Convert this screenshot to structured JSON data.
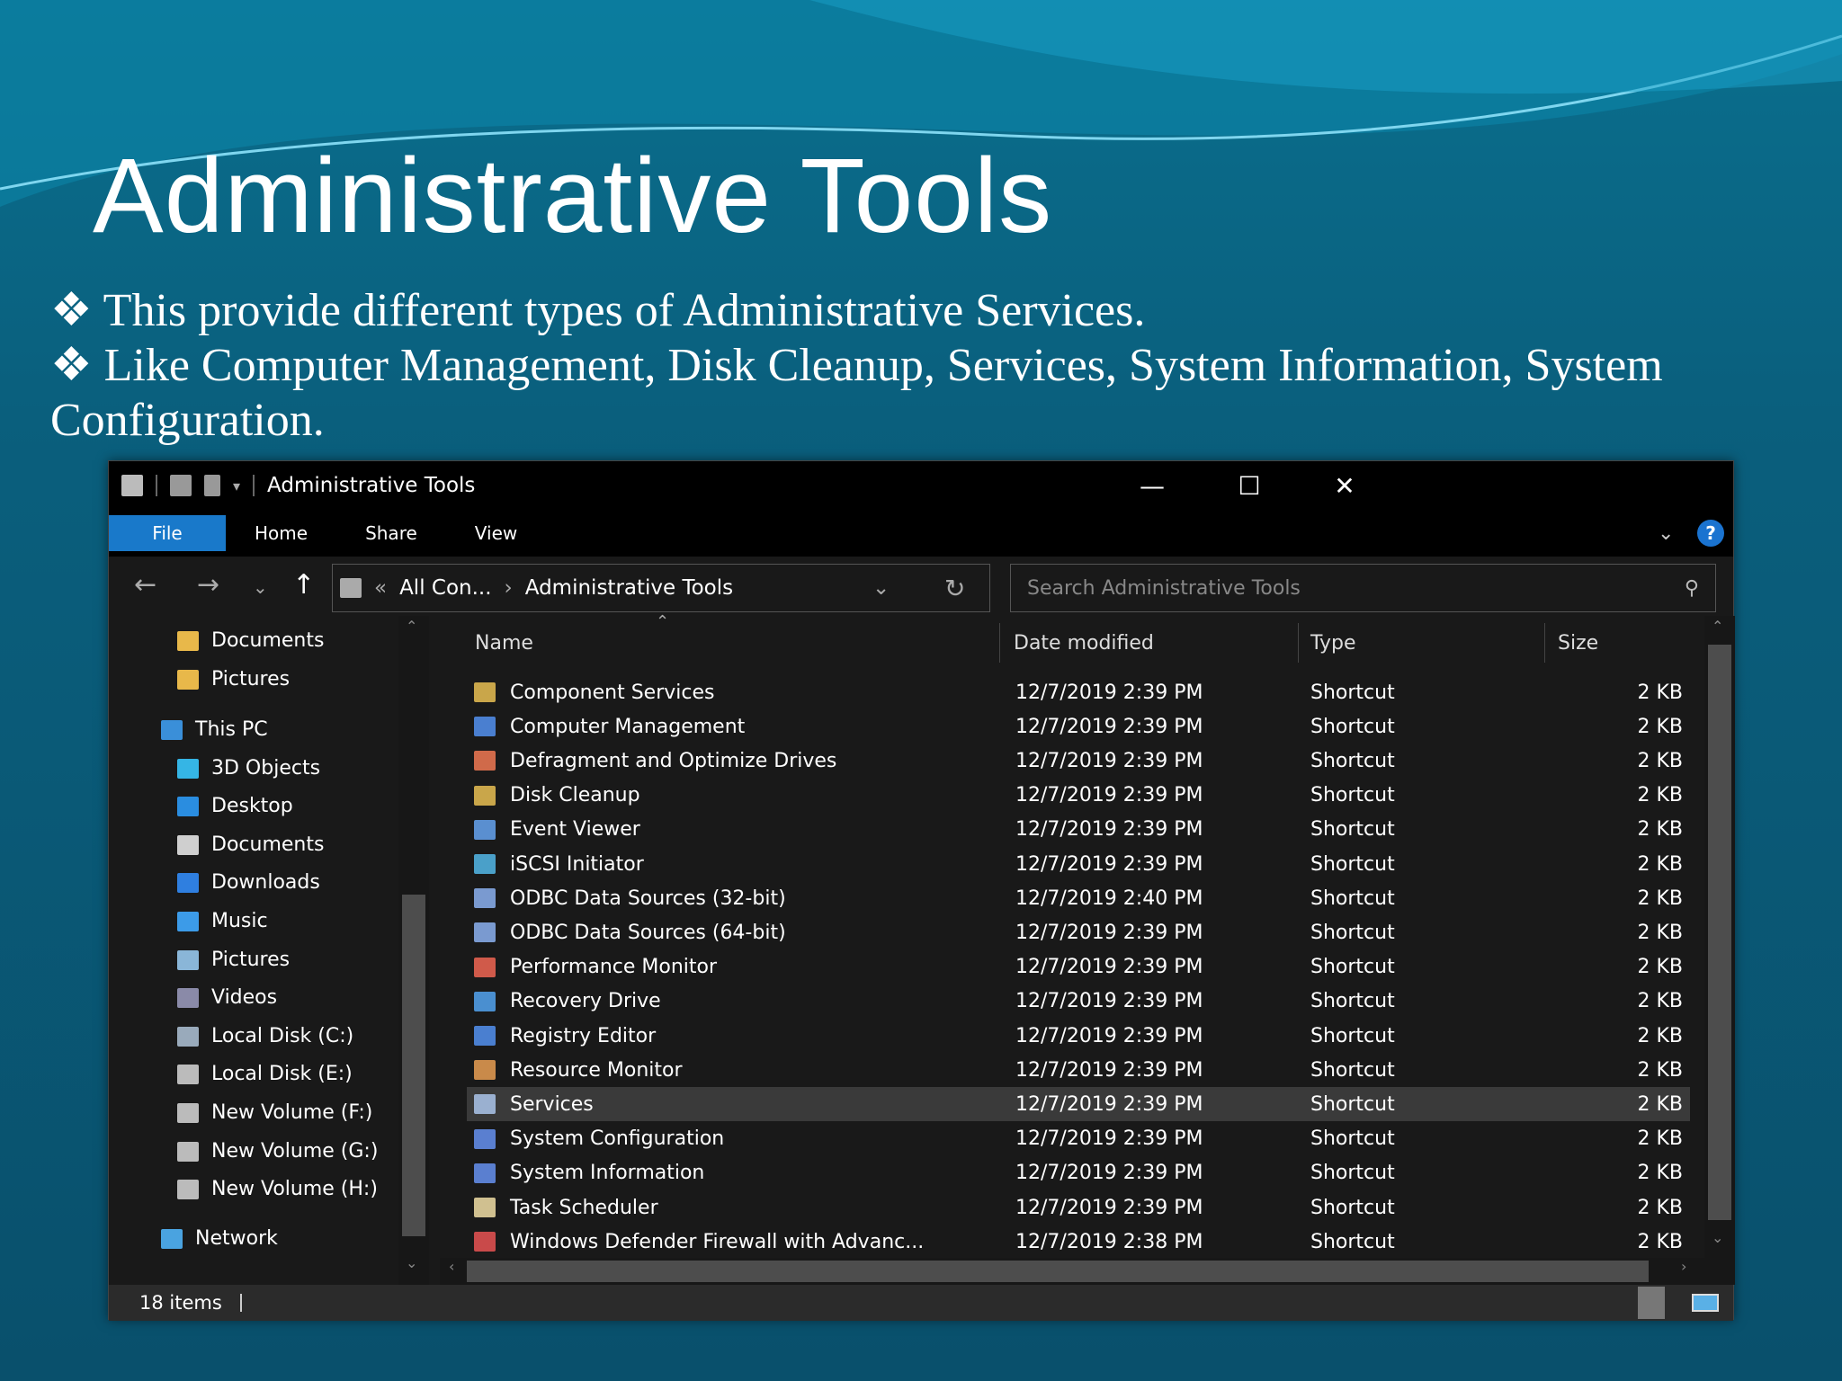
{
  "slide": {
    "title": "Administrative Tools",
    "bullets": [
      "❖ This provide  different types of  Administrative  Services.",
      "❖ Like Computer Management, Disk Cleanup, Services, System Information, System Configuration."
    ]
  },
  "window": {
    "title": "Administrative Tools",
    "ribbon_tabs": [
      "File",
      "Home",
      "Share",
      "View"
    ],
    "help": "?",
    "address": {
      "prefix": "«",
      "parent": "All Con...",
      "sep": "›",
      "current": "Administrative Tools"
    },
    "search_placeholder": "Search Administrative Tools",
    "sidebar": [
      {
        "label": "Documents",
        "icon": "folder-icon",
        "color": "#e8b84a",
        "indent": 1
      },
      {
        "label": "Pictures",
        "icon": "folder-icon",
        "color": "#e8b84a",
        "indent": 1
      },
      {
        "label": "This PC",
        "icon": "computer-icon",
        "color": "#3a8fd9",
        "indent": 0
      },
      {
        "label": "3D Objects",
        "icon": "cube-icon",
        "color": "#35b5e5",
        "indent": 1
      },
      {
        "label": "Desktop",
        "icon": "desktop-icon",
        "color": "#2a8de0",
        "indent": 1
      },
      {
        "label": "Documents",
        "icon": "document-icon",
        "color": "#cfcfcf",
        "indent": 1
      },
      {
        "label": "Downloads",
        "icon": "download-icon",
        "color": "#2f7fe0",
        "indent": 1
      },
      {
        "label": "Music",
        "icon": "music-icon",
        "color": "#3c9be8",
        "indent": 1
      },
      {
        "label": "Pictures",
        "icon": "pictures-icon",
        "color": "#8ab6d8",
        "indent": 1
      },
      {
        "label": "Videos",
        "icon": "videos-icon",
        "color": "#8a8aa8",
        "indent": 1
      },
      {
        "label": "Local Disk (C:)",
        "icon": "drive-icon",
        "color": "#9ab",
        "indent": 1
      },
      {
        "label": "Local Disk (E:)",
        "icon": "drive-icon",
        "color": "#bbb",
        "indent": 1
      },
      {
        "label": "New Volume (F:)",
        "icon": "drive-icon",
        "color": "#bbb",
        "indent": 1
      },
      {
        "label": "New Volume (G:)",
        "icon": "drive-icon",
        "color": "#bbb",
        "indent": 1
      },
      {
        "label": "New Volume (H:)",
        "icon": "drive-icon",
        "color": "#bbb",
        "indent": 1
      },
      {
        "label": "Network",
        "icon": "network-icon",
        "color": "#4aa3e0",
        "indent": 0
      }
    ],
    "columns": [
      "Name",
      "Date modified",
      "Type",
      "Size"
    ],
    "files": [
      [
        "Component Services",
        "12/7/2019 2:39 PM",
        "Shortcut",
        "2 KB"
      ],
      [
        "Computer Management",
        "12/7/2019 2:39 PM",
        "Shortcut",
        "2 KB"
      ],
      [
        "Defragment and Optimize Drives",
        "12/7/2019 2:39 PM",
        "Shortcut",
        "2 KB"
      ],
      [
        "Disk Cleanup",
        "12/7/2019 2:39 PM",
        "Shortcut",
        "2 KB"
      ],
      [
        "Event Viewer",
        "12/7/2019 2:39 PM",
        "Shortcut",
        "2 KB"
      ],
      [
        "iSCSI Initiator",
        "12/7/2019 2:39 PM",
        "Shortcut",
        "2 KB"
      ],
      [
        "ODBC Data Sources (32-bit)",
        "12/7/2019 2:40 PM",
        "Shortcut",
        "2 KB"
      ],
      [
        "ODBC Data Sources (64-bit)",
        "12/7/2019 2:39 PM",
        "Shortcut",
        "2 KB"
      ],
      [
        "Performance Monitor",
        "12/7/2019 2:39 PM",
        "Shortcut",
        "2 KB"
      ],
      [
        "Recovery Drive",
        "12/7/2019 2:39 PM",
        "Shortcut",
        "2 KB"
      ],
      [
        "Registry Editor",
        "12/7/2019 2:39 PM",
        "Shortcut",
        "2 KB"
      ],
      [
        "Resource Monitor",
        "12/7/2019 2:39 PM",
        "Shortcut",
        "2 KB"
      ],
      [
        "Services",
        "12/7/2019 2:39 PM",
        "Shortcut",
        "2 KB"
      ],
      [
        "System Configuration",
        "12/7/2019 2:39 PM",
        "Shortcut",
        "2 KB"
      ],
      [
        "System Information",
        "12/7/2019 2:39 PM",
        "Shortcut",
        "2 KB"
      ],
      [
        "Task Scheduler",
        "12/7/2019 2:39 PM",
        "Shortcut",
        "2 KB"
      ],
      [
        "Windows Defender Firewall with Advanc...",
        "12/7/2019 2:38 PM",
        "Shortcut",
        "2 KB"
      ]
    ],
    "selected_index": 12,
    "status": "18 items"
  }
}
